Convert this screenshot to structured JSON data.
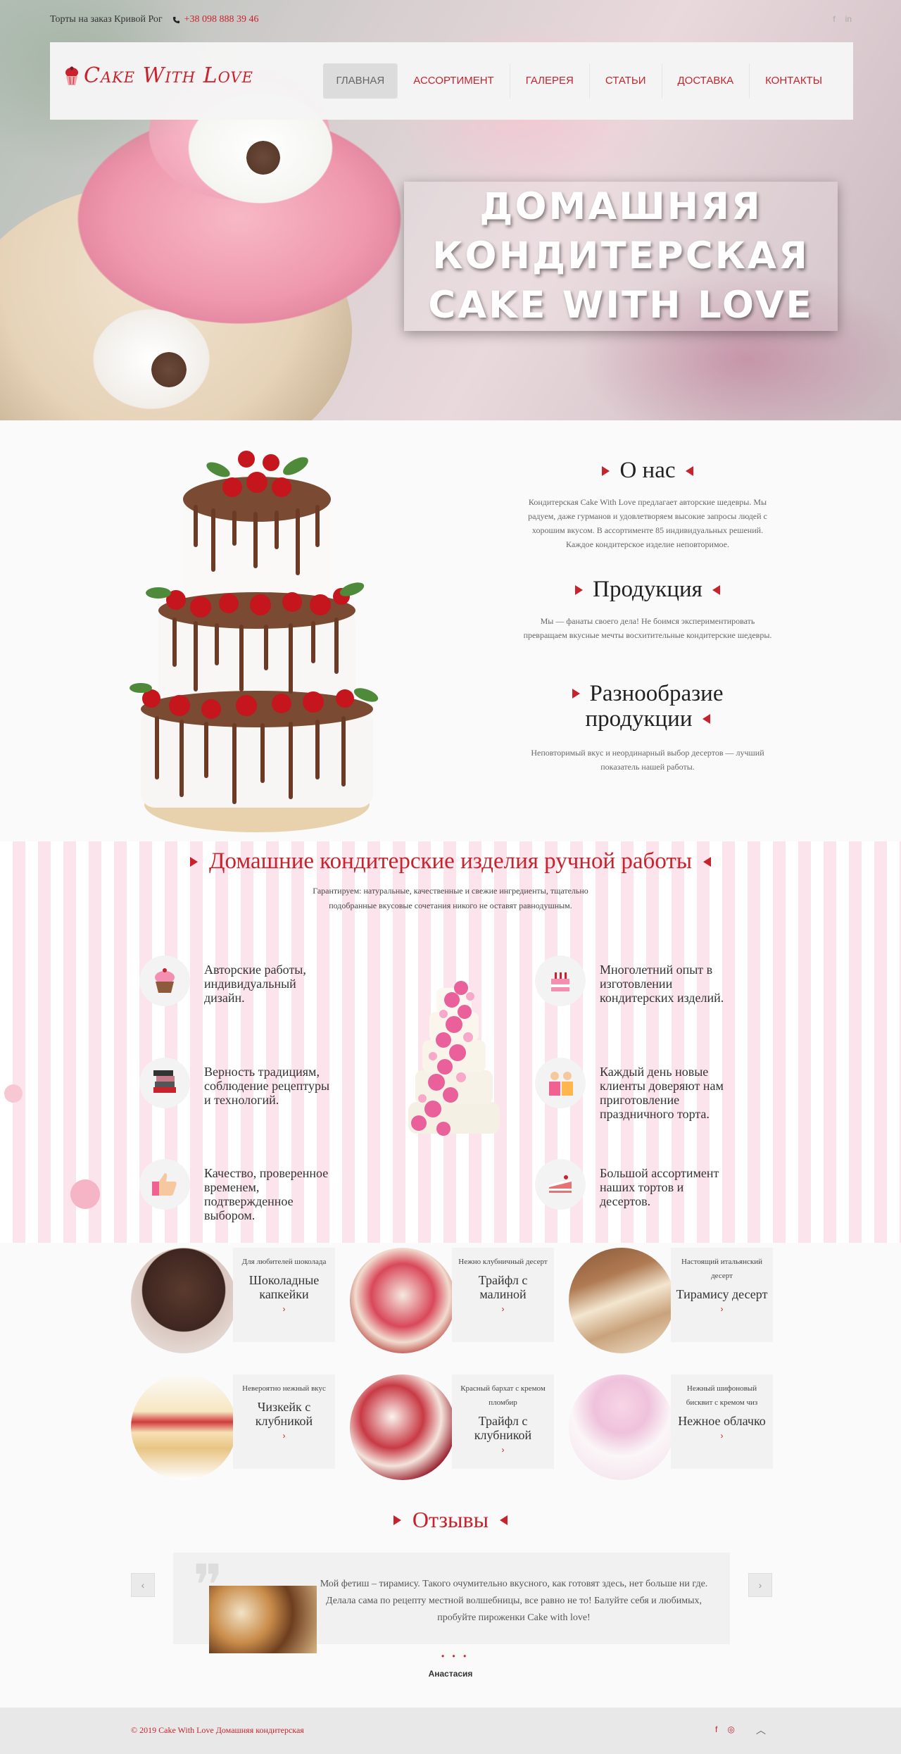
{
  "topbar": {
    "tagline": "Торты на заказ Кривой Рог",
    "phone": "+38 098 888 39 46",
    "social": [
      "f",
      "in"
    ]
  },
  "brand": {
    "logo_text": "Cake With Love",
    "accent": "#c8232c"
  },
  "nav": {
    "items": [
      {
        "label": "ГЛАВНАЯ",
        "active": true
      },
      {
        "label": "АССОРТИМЕНТ"
      },
      {
        "label": "ГАЛЕРЕЯ"
      },
      {
        "label": "СТАТЬИ"
      },
      {
        "label": "ДОСТАВКА"
      },
      {
        "label": "КОНТАКТЫ"
      }
    ]
  },
  "hero": {
    "line1": "ДОМАШНЯЯ",
    "line2": "КОНДИТЕРСКАЯ",
    "line3": "CAKE WITH LOVE"
  },
  "about": {
    "sections": [
      {
        "title": "О нас",
        "text": "Кондитерская Cake With Love предлагает авторские шедевры. Мы радуем, даже гурманов и удовлетворяем высокие запросы людей с хорошим вкусом. В ассортименте 85 индивидуальных решений. Каждое кондитерское изделие неповторимое."
      },
      {
        "title": "Продукция",
        "text": "Мы — фанаты своего дела! Не боимся экспериментировать превращаем вкусные мечты восхитительные кондитерские шедевры."
      },
      {
        "title_line1": "Разнообразие",
        "title_line2": "продукции",
        "text": "Неповторимый вкус и неординарный выбор десертов — лучший показатель нашей работы."
      }
    ]
  },
  "handmade": {
    "title": "Домашние кондитерские изделия ручной работы",
    "subtitle": "Гарантируем: натуральные, качественные и свежие ингредиенты, тщательно подобранные вкусовые сочетания никого не оставят равнодушным.",
    "features": [
      {
        "icon": "cupcake-icon",
        "text": "Авторские работы, индивидуальный дизайн."
      },
      {
        "icon": "books-icon",
        "text": "Верность традициям, соблюдение рецептуры и технологий."
      },
      {
        "icon": "thumbs-up-icon",
        "text": "Качество, проверенное временем, подтвержденное выбором."
      },
      {
        "icon": "birthday-cake-icon",
        "text": "Многолетний опыт в изготовлении кондитерских изделий."
      },
      {
        "icon": "customers-icon",
        "text": "Каждый день новые клиенты доверяют нам приготовление праздничного торта."
      },
      {
        "icon": "cake-slice-icon",
        "text": "Большой ассортимент наших тортов и десертов."
      }
    ]
  },
  "products": [
    {
      "small": "Для любителей шоколада",
      "name": "Шоколадные капкейки",
      "arrow": "›"
    },
    {
      "small": "Нежно клубничный десерт",
      "name": "Трайфл с малиной",
      "arrow": "›"
    },
    {
      "small": "Настоящий итальянский десерт",
      "name": "Тирамису десерт",
      "arrow": "›"
    },
    {
      "small": "Невероятно нежный вкус",
      "name": "Чизкейк с клубникой",
      "arrow": "›"
    },
    {
      "small": "Красный бархат с кремом пломбир",
      "name": "Трайфл с клубникой",
      "arrow": "›"
    },
    {
      "small": "Нежный шифоновый бисквит с кремом чиз",
      "name": "Нежное облачко",
      "arrow": "›"
    }
  ],
  "reviews": {
    "title": "Отзывы",
    "text": "Мой фетиш – тирамису. Такого очумительно вкусного, как готовят здесь, нет больше ни где. Делала сама по рецепту местной волшебницы, все равно не то! Балуйте себя и любимых, пробуйте пироженки Cake with love!",
    "author": "Анастасия",
    "prev": "‹",
    "next": "›",
    "dots": "• • •"
  },
  "footer": {
    "copyright": "© 2019 Cake With Love Домашняя кондитерская",
    "social": [
      "f",
      "◎"
    ],
    "to_top": "︿"
  }
}
